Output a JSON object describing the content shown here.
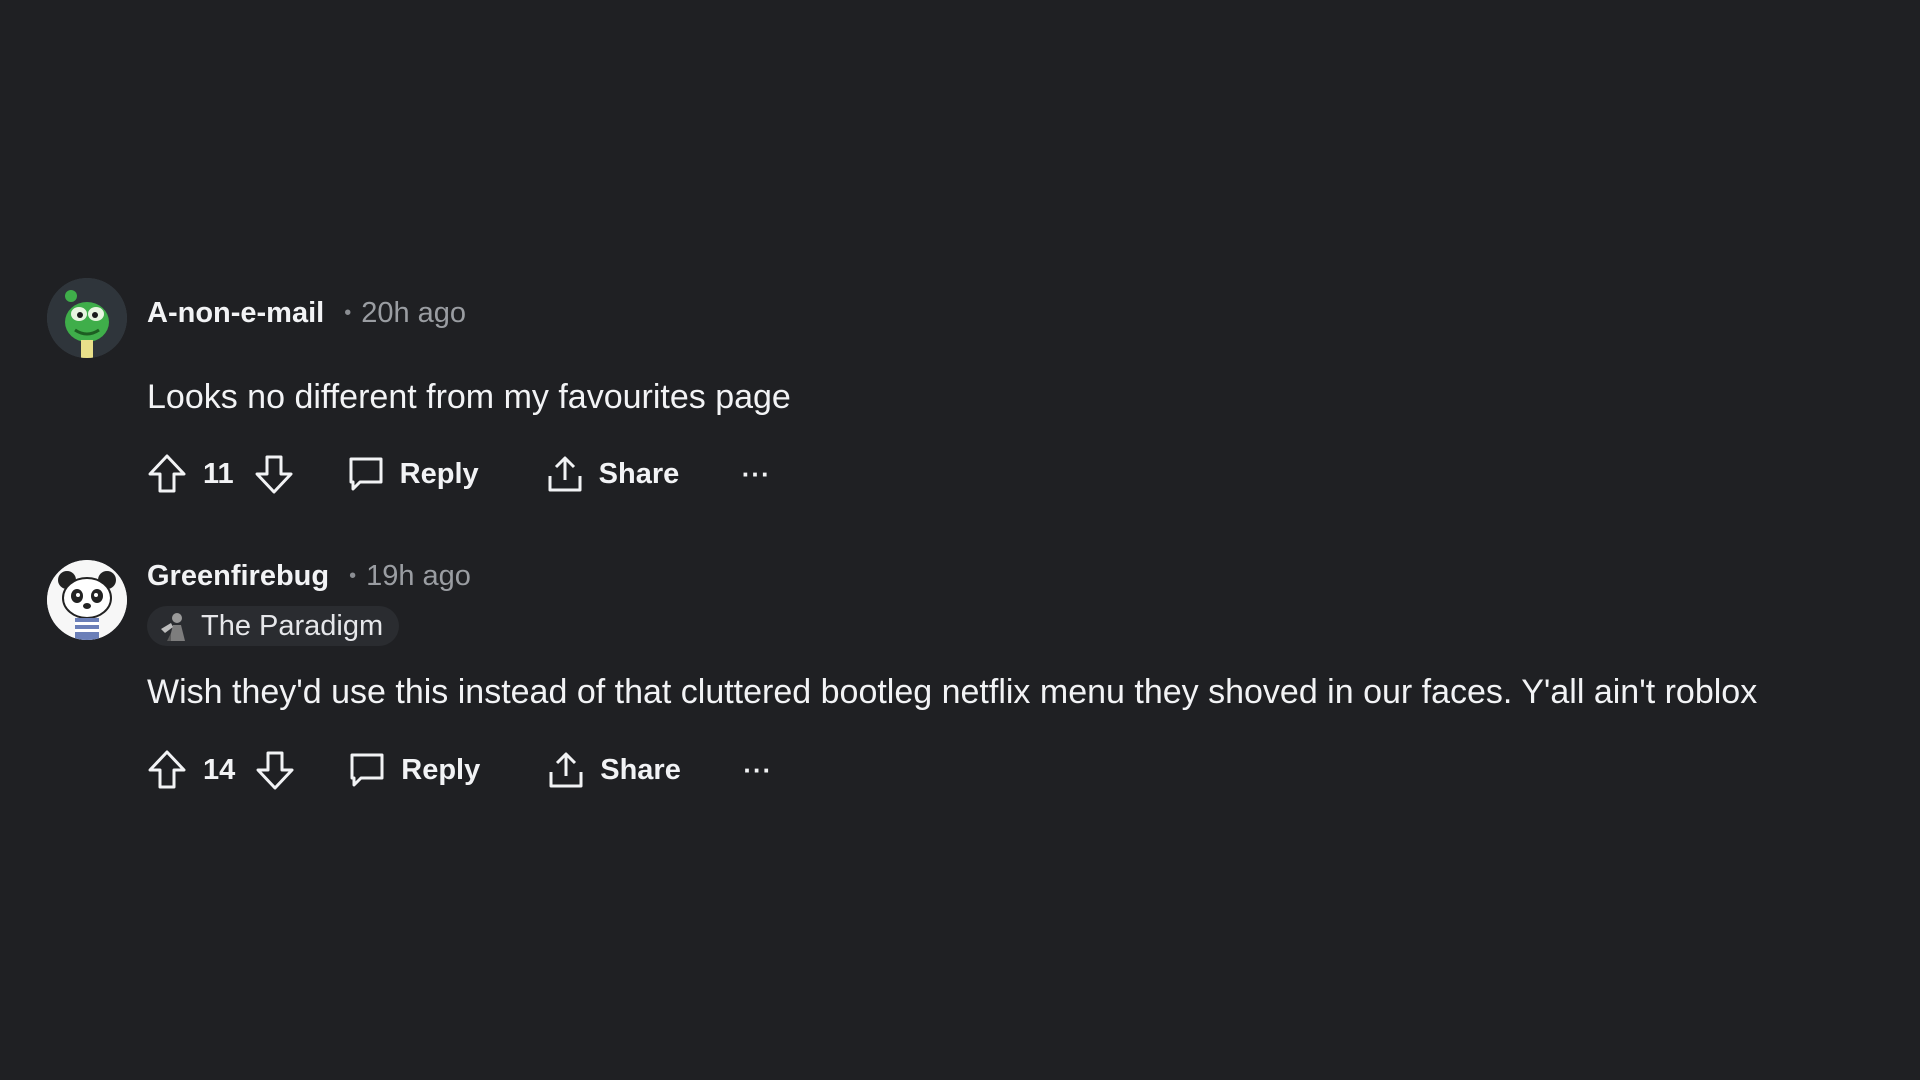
{
  "comments": [
    {
      "username": "A-non-e-mail",
      "separator": "•",
      "time": "20h ago",
      "body": "Looks no different from my favourites page",
      "score": "11",
      "reply_label": "Reply",
      "share_label": "Share",
      "more_label": "···"
    },
    {
      "username": "Greenfirebug",
      "separator": "•",
      "time": "19h ago",
      "flair": "The Paradigm",
      "body": "Wish they'd use this instead of that cluttered bootleg netflix menu they shoved in our faces. Y'all ain't roblox",
      "score": "14",
      "reply_label": "Reply",
      "share_label": "Share",
      "more_label": "···"
    }
  ],
  "colors": {
    "background": "#1f2023",
    "text_primary": "#f2f3f5",
    "text_secondary": "#9a9da2",
    "flair_bg": "#2a2c30"
  },
  "icons": [
    "upvote-icon",
    "downvote-icon",
    "comment-bubble-icon",
    "share-upload-icon",
    "more-dots-icon"
  ]
}
